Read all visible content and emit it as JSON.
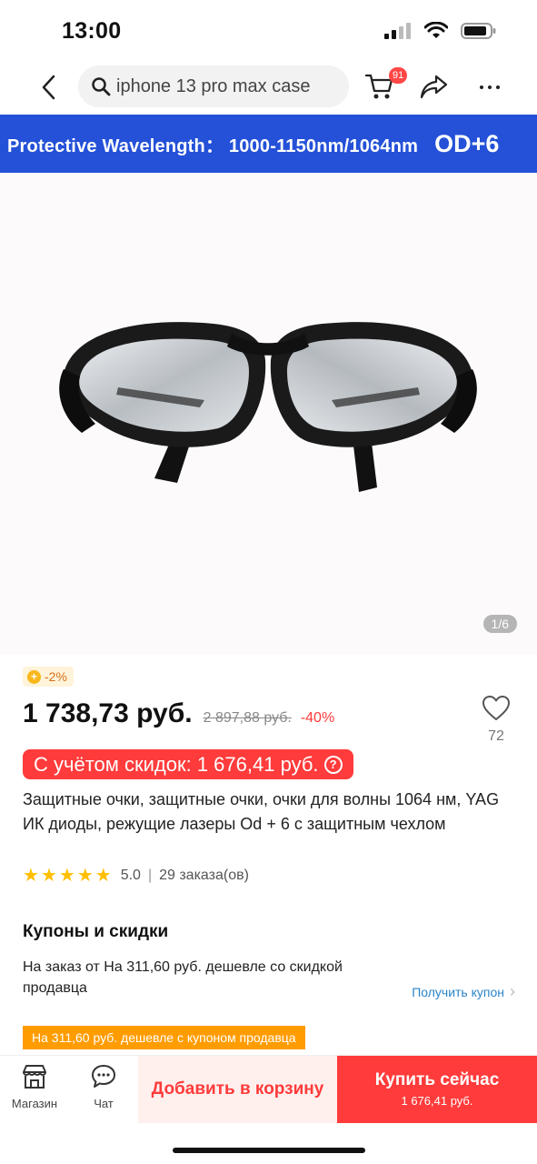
{
  "status_bar": {
    "time": "13:00"
  },
  "nav": {
    "search_value": "iphone 13 pro max case",
    "cart_count": "91"
  },
  "product_image": {
    "banner_text": "Protective Wavelength： 1000-1150nm/1064nm",
    "banner_od": "OD+6",
    "counter": "1/6"
  },
  "price": {
    "coin_badge": "-2%",
    "current": "1 738,73 руб.",
    "old": "2 897,88 руб.",
    "discount": "-40%",
    "with_discounts": "С учётом скидок: 1 676,41 руб.",
    "help_icon": "?"
  },
  "wishlist": {
    "count": "72"
  },
  "product": {
    "title": "Защитные очки, защитные очки, очки для волны 1064 нм, YAG ИК диоды, режущие лазеры Od + 6 с защитным чехлом",
    "rating": 5.0,
    "rating_text": "5.0",
    "orders": "29 заказа(ов)"
  },
  "coupons": {
    "section_title": "Купоны и скидки",
    "description": "На заказ от На 311,60 руб. дешевле со скидкой продавца",
    "get_coupon": "Получить купон",
    "tag": "На 311,60 руб. дешевле с купоном продавца"
  },
  "bottom_bar": {
    "store_label": "Магазин",
    "chat_label": "Чат",
    "add_to_cart": "Добавить в корзину",
    "buy_now": "Купить сейчас",
    "buy_now_price": "1 676,41 руб."
  },
  "colors": {
    "accent_red": "#ff3b3b",
    "banner_blue": "#2451d8",
    "coupon_orange": "#ff9c00",
    "star_yellow": "#ffbf00"
  },
  "icons": [
    "back-arrow-icon",
    "search-icon",
    "cart-icon",
    "share-icon",
    "more-icon",
    "heart-icon",
    "store-icon",
    "chat-icon",
    "star-icon",
    "chevron-right-icon"
  ]
}
